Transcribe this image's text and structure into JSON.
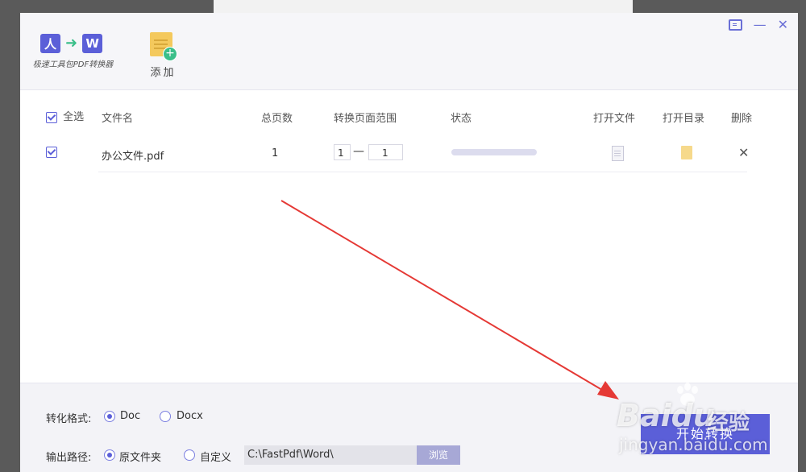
{
  "app": {
    "logo_text": "极速工具包PDF转换器",
    "logo_pdf_glyph": "人",
    "logo_word_glyph": "W",
    "add_label": "添加"
  },
  "window_controls": {
    "feedback": "feedback-icon",
    "minimize": "—",
    "close": "✕"
  },
  "table": {
    "headers": {
      "select_all": "全选",
      "filename": "文件名",
      "total_pages": "总页数",
      "page_range": "转换页面范围",
      "status": "状态",
      "open_file": "打开文件",
      "open_dir": "打开目录",
      "delete": "删除"
    },
    "rows": [
      {
        "checked": true,
        "filename": "办公文件.pdf",
        "total_pages": "1",
        "range_from": "1",
        "range_sep": "—",
        "range_to": "1",
        "progress": 0,
        "delete_glyph": "✕"
      }
    ]
  },
  "settings": {
    "format_label": "转化格式:",
    "format_options": [
      "Doc",
      "Docx"
    ],
    "format_selected": "Doc",
    "output_label": "输出路径:",
    "output_options": [
      "原文件夹",
      "自定义"
    ],
    "output_selected": "原文件夹",
    "path_value": "C:\\FastPdf\\Word\\",
    "browse_label": "浏览",
    "start_label": "开始转换"
  },
  "watermark": {
    "brand": "Baidu",
    "brand_cn": "经验",
    "url": "jingyan.baidu.com"
  },
  "colors": {
    "accent": "#5b5fd8",
    "annotation_arrow": "#e53935"
  }
}
